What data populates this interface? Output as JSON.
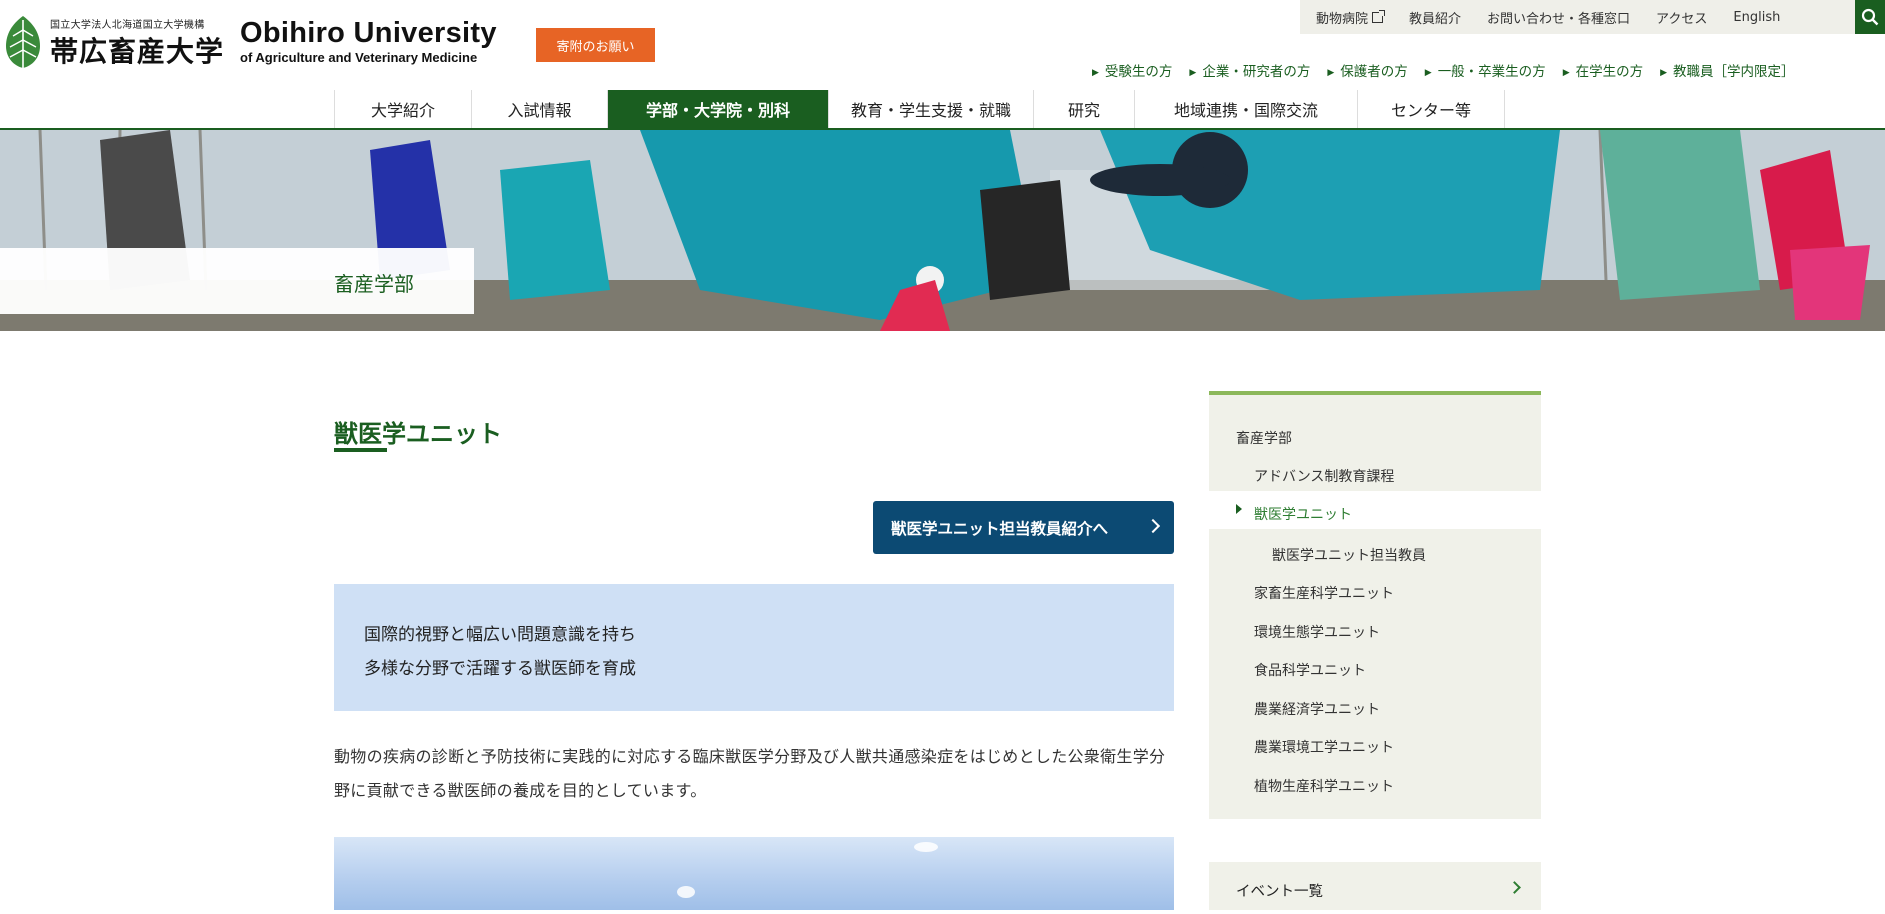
{
  "header": {
    "logo_small": "国立大学法人北海道国立大学機構",
    "logo_jp": "帯広畜産大学",
    "logo_en_1": "Obihiro University",
    "logo_en_2": "of Agriculture and Veterinary Medicine",
    "donate_label": "寄附のお願い"
  },
  "utility_nav": [
    {
      "label": "動物病院",
      "external": true
    },
    {
      "label": "教員紹介"
    },
    {
      "label": "お問い合わせ・各種窓口"
    },
    {
      "label": "アクセス"
    },
    {
      "label": "English"
    }
  ],
  "audience_nav": [
    "受験生の方",
    "企業・研究者の方",
    "保護者の方",
    "一般・卒業生の方",
    "在学生の方",
    "教職員［学内限定］"
  ],
  "main_nav": [
    {
      "label": "大学紹介"
    },
    {
      "label": "入試情報"
    },
    {
      "label": "学部・大学院・別科",
      "active": true
    },
    {
      "label": "教育・学生支援・就職"
    },
    {
      "label": "研究"
    },
    {
      "label": "地域連携・国際交流"
    },
    {
      "label": "センター等"
    }
  ],
  "hero": {
    "label": "畜産学部"
  },
  "content": {
    "title": "獣医学ユニット",
    "cta_label": "獣医学ユニット担当教員紹介へ",
    "lead_line_1": "国際的視野と幅広い問題意識を持ち",
    "lead_line_2": "多様な分野で活躍する獣医師を育成",
    "body": "動物の疾病の診断と予防技術に実践的に対応する臨床獣医学分野及び人獣共通感染症をはじめとした公衆衛生学分野に貢献できる獣医師の養成を目的としています。"
  },
  "sidebar": {
    "items": [
      {
        "label": "畜産学部",
        "level": 1
      },
      {
        "label": "アドバンス制教育課程",
        "level": 2
      },
      {
        "label": "獣医学ユニット",
        "level": 2,
        "active": true
      },
      {
        "label": "獣医学ユニット担当教員",
        "level": 3
      },
      {
        "label": "家畜生産科学ユニット",
        "level": 2
      },
      {
        "label": "環境生態学ユニット",
        "level": 2
      },
      {
        "label": "食品科学ユニット",
        "level": 2
      },
      {
        "label": "農業経済学ユニット",
        "level": 2
      },
      {
        "label": "農業環境工学ユニット",
        "level": 2
      },
      {
        "label": "植物生産科学ユニット",
        "level": 2
      }
    ],
    "event_label": "イベント一覧"
  },
  "colors": {
    "brand_green": "#1a5e20",
    "accent_orange": "#e76425",
    "cta_navy": "#0c4a73",
    "lead_bg": "#cfe0f5",
    "sidebar_bg": "#f0f1e9",
    "sidebar_accent": "#8cb85a"
  }
}
